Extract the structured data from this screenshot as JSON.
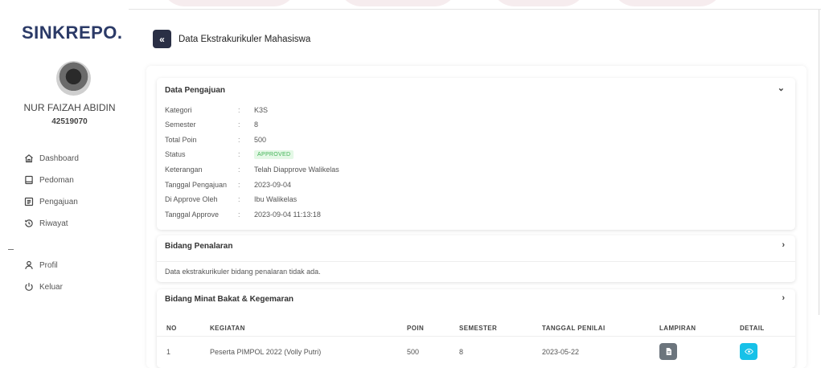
{
  "sidebar": {
    "brand": "SINKREPO.",
    "user_name": "NUR FAIZAH ABIDIN",
    "user_id": "42519070",
    "menu": [
      {
        "label": "Dashboard",
        "icon": "home-icon"
      },
      {
        "label": "Pedoman",
        "icon": "book-icon"
      },
      {
        "label": "Pengajuan",
        "icon": "document-list-icon"
      },
      {
        "label": "Riwayat",
        "icon": "history-icon"
      }
    ],
    "account_menu": [
      {
        "label": "Profil",
        "icon": "user-icon"
      },
      {
        "label": "Keluar",
        "icon": "power-icon"
      }
    ]
  },
  "header": {
    "back_icon": "«",
    "title": "Data Ekstrakurikuler Mahasiswa"
  },
  "pengajuan": {
    "title": "Data Pengajuan",
    "chevron": "⌄",
    "fields": [
      {
        "key": "Kategori",
        "value": "K3S"
      },
      {
        "key": "Semester",
        "value": "8"
      },
      {
        "key": "Total Poin",
        "value": "500"
      },
      {
        "key": "Status",
        "value": "APPROVED"
      },
      {
        "key": "Keterangan",
        "value": "Telah Diapprove Walikelas"
      },
      {
        "key": "Tanggal Pengajuan",
        "value": "2023-09-04"
      },
      {
        "key": "Di Approve Oleh",
        "value": "Ibu Walikelas"
      },
      {
        "key": "Tanggal Approve",
        "value": "2023-09-04 11:13:18"
      }
    ],
    "colon": ":"
  },
  "penalaran": {
    "title": "Bidang Penalaran",
    "chevron": "›",
    "empty_text": "Data ekstrakurikuler bidang penalaran tidak ada."
  },
  "minat": {
    "title": "Bidang Minat Bakat & Kegemaran",
    "chevron": "›",
    "columns": [
      "NO",
      "KEGIATAN",
      "POIN",
      "SEMESTER",
      "TANGGAL PENILAI",
      "LAMPIRAN",
      "DETAIL"
    ],
    "rows": [
      {
        "no": "1",
        "kegiatan": "Peserta PIMPOL 2022 (Volly Putri)",
        "poin": "500",
        "semester": "8",
        "tanggal": "2023-05-22"
      }
    ]
  },
  "colors": {
    "brand": "#2b3a67",
    "back_button": "#2a2f45",
    "approved_bg": "#e4f8e6",
    "approved_text": "#42b356",
    "lampiran_button": "#6c757d",
    "detail_button": "#17c1e8"
  }
}
